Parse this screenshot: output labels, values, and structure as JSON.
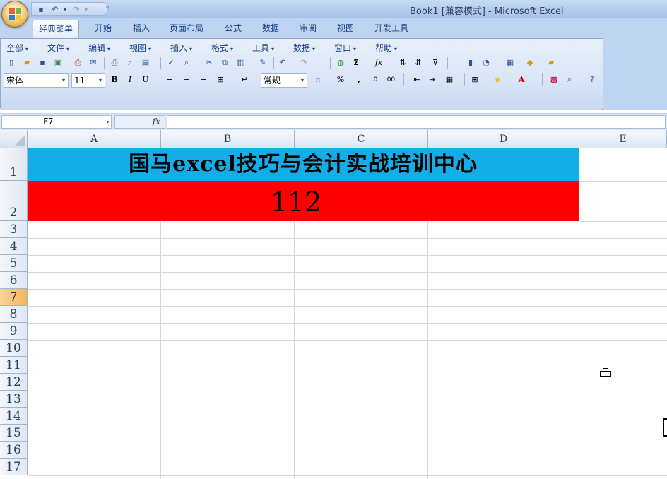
{
  "window": {
    "title": "Book1  [兼容模式] - Microsoft Excel"
  },
  "quick_access": {
    "icons": [
      "save-icon",
      "undo-icon",
      "redo-icon",
      "customize-qat-icon"
    ]
  },
  "tabs": [
    {
      "label": "经典菜单",
      "active": true
    },
    {
      "label": "开始"
    },
    {
      "label": "插入"
    },
    {
      "label": "页面布局"
    },
    {
      "label": "公式"
    },
    {
      "label": "数据"
    },
    {
      "label": "审阅"
    },
    {
      "label": "视图"
    },
    {
      "label": "开发工具"
    }
  ],
  "menus": [
    {
      "label": "全部"
    },
    {
      "label": "文件"
    },
    {
      "label": "编辑"
    },
    {
      "label": "视图"
    },
    {
      "label": "插入"
    },
    {
      "label": "格式"
    },
    {
      "label": "工具"
    },
    {
      "label": "数据"
    },
    {
      "label": "窗口"
    },
    {
      "label": "帮助"
    }
  ],
  "toolbar": {
    "font_name": "宋体",
    "font_size": "11",
    "bold": "B",
    "italic": "I",
    "underline": "U",
    "number_format": "常规",
    "percent": "%",
    "comma": ",",
    "sum": "Σ",
    "fx": "fx",
    "font_color_label": "A"
  },
  "formula_bar": {
    "name_box": "F7",
    "fx_label": "fx",
    "formula": ""
  },
  "sheet": {
    "columns": [
      "A",
      "B",
      "C",
      "D",
      "E"
    ],
    "rows": [
      "1",
      "2",
      "3",
      "4",
      "5",
      "6",
      "7",
      "8",
      "9",
      "10",
      "11",
      "12",
      "13",
      "14",
      "15",
      "16",
      "17"
    ],
    "selected_row": "7",
    "cells": {
      "A1": "国马excel技巧与会计实战培训中心",
      "A2": "112"
    },
    "colors": {
      "title_fill": "#13aee7",
      "number_fill": "#ff0000"
    }
  }
}
